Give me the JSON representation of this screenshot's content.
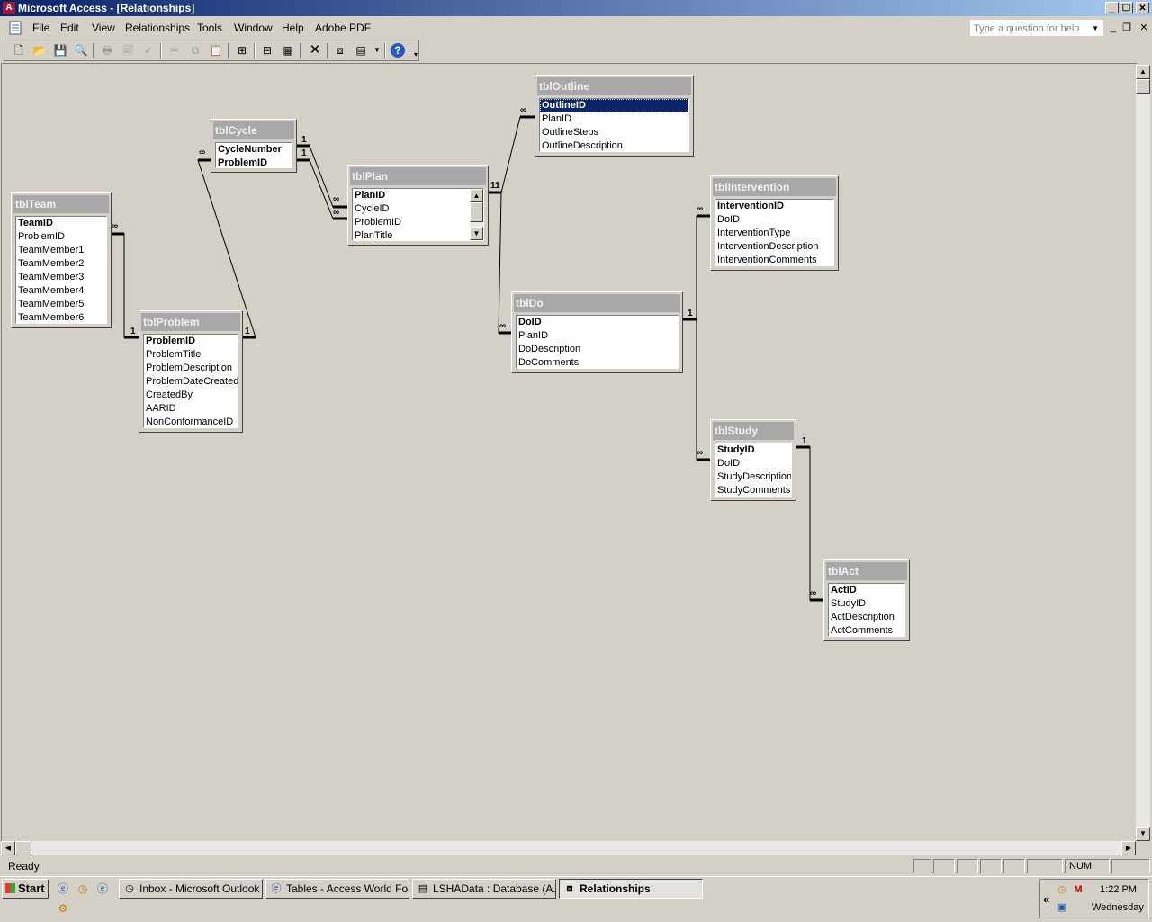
{
  "window": {
    "title": "Microsoft Access - [Relationships]"
  },
  "menu": {
    "items": [
      "File",
      "Edit",
      "View",
      "Relationships",
      "Tools",
      "Window",
      "Help",
      "Adobe PDF"
    ],
    "help_placeholder": "Type a question for help"
  },
  "toolbar": {
    "icons": [
      "new-icon",
      "open-icon",
      "save-icon",
      "print-preview-icon",
      "print-icon",
      "preview-icon",
      "spelling-icon",
      "cut-icon",
      "copy-icon",
      "paste-icon",
      "show-table-icon",
      "show-direct-icon",
      "show-all-icon",
      "delete-icon",
      "relationships-icon",
      "new-object-icon",
      "help-icon"
    ]
  },
  "tables": {
    "team": {
      "title": "tblTeam",
      "fields": [
        "TeamID",
        "ProblemID",
        "TeamMember1",
        "TeamMember2",
        "TeamMember3",
        "TeamMember4",
        "TeamMember5",
        "TeamMember6"
      ]
    },
    "problem": {
      "title": "tblProblem",
      "fields": [
        "ProblemID",
        "ProblemTitle",
        "ProblemDescription",
        "ProblemDateCreated",
        "CreatedBy",
        "AARID",
        "NonConformanceID"
      ]
    },
    "cycle": {
      "title": "tblCycle",
      "fields": [
        "CycleNumber",
        "ProblemID"
      ]
    },
    "plan": {
      "title": "tblPlan",
      "fields": [
        "PlanID",
        "CycleID",
        "ProblemID",
        "PlanTitle"
      ]
    },
    "outline": {
      "title": "tblOutline",
      "fields": [
        "OutlineID",
        "PlanID",
        "OutlineSteps",
        "OutlineDescription"
      ]
    },
    "intervention": {
      "title": "tblIntervention",
      "fields": [
        "InterventionID",
        "DoID",
        "InterventionType",
        "InterventionDescription",
        "InterventionComments"
      ]
    },
    "do": {
      "title": "tblDo",
      "fields": [
        "DoID",
        "PlanID",
        "DoDescription",
        "DoComments"
      ]
    },
    "study": {
      "title": "tblStudy",
      "fields": [
        "StudyID",
        "DoID",
        "StudyDescription",
        "StudyComments"
      ]
    },
    "act": {
      "title": "tblAct",
      "fields": [
        "ActID",
        "StudyID",
        "ActDescription",
        "ActComments"
      ]
    }
  },
  "cardinality": {
    "one": "1",
    "many": "∞"
  },
  "status": {
    "text": "Ready",
    "num": "NUM"
  },
  "taskbar": {
    "start": "Start",
    "tasks": [
      "Inbox - Microsoft Outlook",
      "Tables - Access World Fo...",
      "LSHAData : Database (A...",
      "Relationships"
    ],
    "time": "1:22 PM",
    "day": "Wednesday"
  }
}
